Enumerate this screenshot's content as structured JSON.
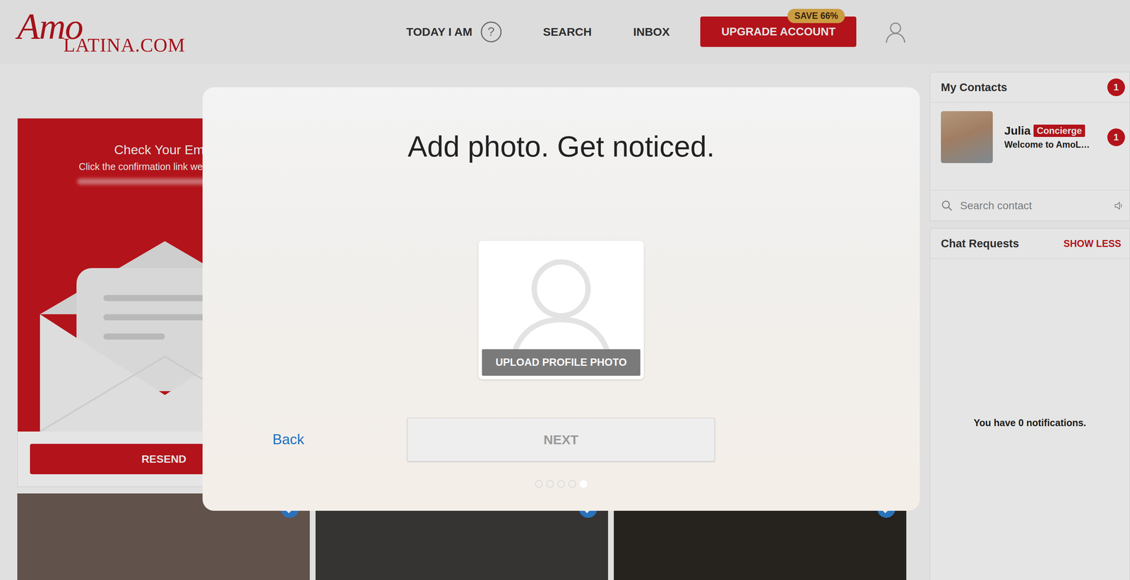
{
  "logo": {
    "script": "Amo",
    "wordmark": "LATINA.COM"
  },
  "nav": [
    {
      "label": "TODAY I AM",
      "kind": "help"
    },
    {
      "label": "SEARCH",
      "kind": "link"
    },
    {
      "label": "INBOX",
      "kind": "link"
    }
  ],
  "help_icon": "?",
  "upgrade": {
    "label": "UPGRADE ACCOUNT",
    "badge": "SAVE 66%"
  },
  "email_card": {
    "title": "Check Your Ema",
    "subtitle": "Click the confirmation link we",
    "button": "RESEND"
  },
  "profiles": [
    {
      "verified": true
    },
    {
      "verified": true
    },
    {
      "verified": true
    }
  ],
  "modal": {
    "title": "Add photo. Get noticed.",
    "upload": "UPLOAD PROFILE PHOTO",
    "back": "Back",
    "next": "NEXT",
    "next_disabled": true,
    "steps": [
      {
        "selected": false
      },
      {
        "selected": false
      },
      {
        "selected": false
      },
      {
        "selected": false
      },
      {
        "selected": true
      }
    ]
  },
  "contacts": {
    "title": "My Contacts",
    "count": "1",
    "items": [
      {
        "name": "Julia",
        "tag": "Concierge",
        "preview": "Welcome to AmoL…",
        "unread": "1"
      }
    ],
    "search_placeholder": "Search contact"
  },
  "chat_requests": {
    "title": "Chat Requests",
    "toggle": "SHOW LESS",
    "empty": "You have 0 notifications."
  }
}
